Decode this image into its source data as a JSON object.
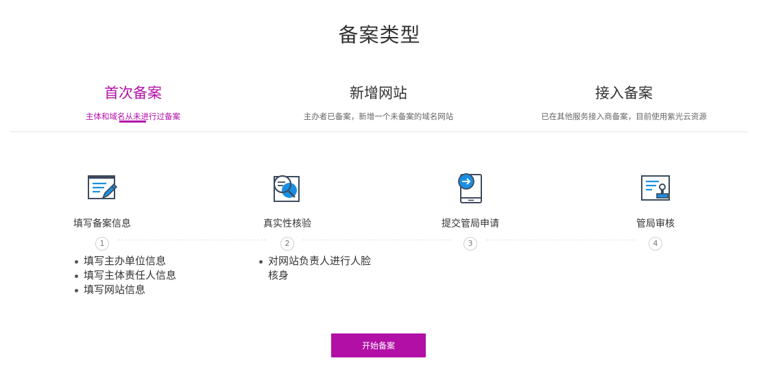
{
  "page_title": "备案类型",
  "tabs": [
    {
      "title": "首次备案",
      "subtitle": "主体和域名从未进行过备案",
      "active": true
    },
    {
      "title": "新增网站",
      "subtitle": "主办者已备案，新增一个未备案的域名网站",
      "active": false
    },
    {
      "title": "接入备案",
      "subtitle": "已在其他服务接入商备案，目前使用紫光云资源",
      "active": false
    }
  ],
  "steps": [
    {
      "label": "填写备案信息",
      "number": "1",
      "icon": "edit-form-icon"
    },
    {
      "label": "真实性核验",
      "number": "2",
      "icon": "search-verify-icon"
    },
    {
      "label": "提交管局申请",
      "number": "3",
      "icon": "submit-tablet-icon"
    },
    {
      "label": "管局审核",
      "number": "4",
      "icon": "stamp-review-icon"
    }
  ],
  "step1_bullets": [
    "填写主办单位信息",
    "填写主体责任人信息",
    "填写网站信息"
  ],
  "step2_bullets": [
    "对网站负责人进行人脸",
    "核身"
  ],
  "start_button": "开始备案",
  "colors": {
    "accent": "#b20fa6",
    "icon_blue": "#1a8fe3",
    "icon_dark": "#3d4a5c"
  }
}
